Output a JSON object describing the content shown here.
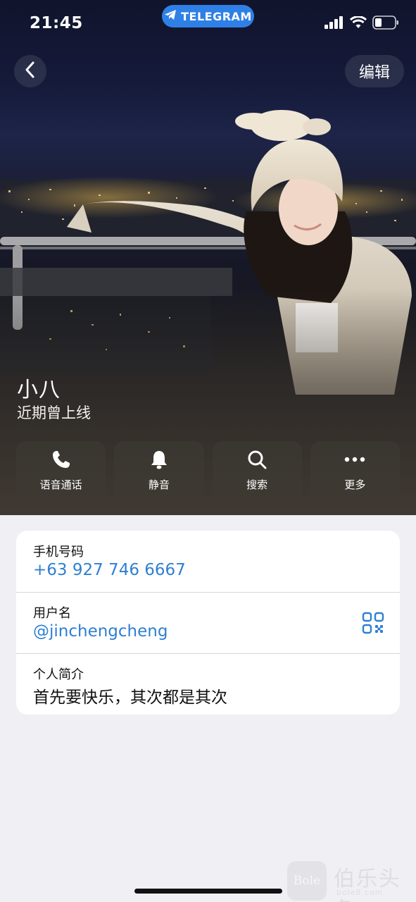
{
  "status_bar": {
    "time": "21:45",
    "app_pill": "TELEGRAM"
  },
  "header": {
    "edit_label": "编辑"
  },
  "profile": {
    "name": "小八",
    "last_seen": "近期曾上线"
  },
  "actions": [
    {
      "label": "语音通话",
      "icon": "phone-icon"
    },
    {
      "label": "静音",
      "icon": "bell-icon"
    },
    {
      "label": "搜索",
      "icon": "search-icon"
    },
    {
      "label": "更多",
      "icon": "more-icon"
    }
  ],
  "info": {
    "phone_label": "手机号码",
    "phone_value": "+63 927 746 6667",
    "username_label": "用户名",
    "username_value": "@jinchengcheng",
    "bio_label": "个人简介",
    "bio_value": "首先要快乐，其次都是其次"
  },
  "watermark": {
    "logo_text": "Bole",
    "title": "伯乐头条",
    "subtitle": "bole8.com"
  },
  "colors": {
    "link": "#2f7fd2",
    "telegram_pill": "#2f80e6",
    "background": "#efeff4"
  }
}
